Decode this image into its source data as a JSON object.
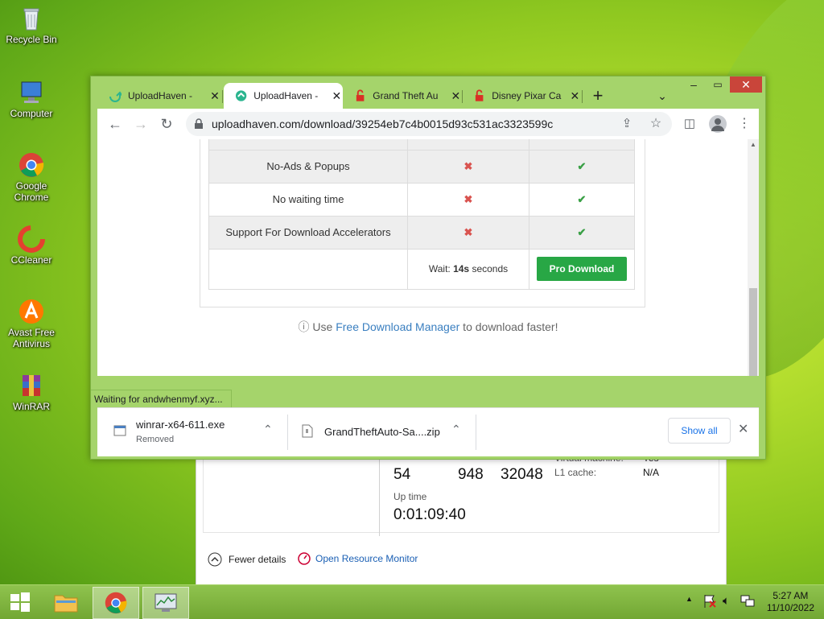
{
  "desktop": {
    "icons": [
      {
        "label": "Recycle Bin",
        "icon": "recycle-bin-icon"
      },
      {
        "label": "Computer",
        "icon": "computer-icon"
      },
      {
        "label": "Google Chrome",
        "icon": "chrome-icon"
      },
      {
        "label": "CCleaner",
        "icon": "ccleaner-icon"
      },
      {
        "label": "Avast Free Antivirus",
        "icon": "avast-icon"
      },
      {
        "label": "WinRAR",
        "icon": "winrar-icon"
      }
    ]
  },
  "browser": {
    "tabs": [
      {
        "title": "UploadHaven - ",
        "icon": "uploadhaven-icon",
        "active": false
      },
      {
        "title": "UploadHaven - ",
        "icon": "uploadhaven-icon",
        "active": true
      },
      {
        "title": "Grand Theft Au",
        "icon": "lock-warning-icon",
        "active": false
      },
      {
        "title": "Disney Pixar Ca",
        "icon": "lock-warning-icon",
        "active": false
      }
    ],
    "url": "uploadhaven.com/download/39254eb7c4b0015d93c531ac3323599c",
    "status_text": "Waiting for andwhenmyf.xyz...",
    "accent": "#a5d46b"
  },
  "page": {
    "features": [
      {
        "label": "No-Ads & Popups",
        "free": "✖",
        "pro": "✔"
      },
      {
        "label": "No waiting time",
        "free": "✖",
        "pro": "✔"
      },
      {
        "label": "Support For Download Accelerators",
        "free": "✖",
        "pro": "✔"
      }
    ],
    "wait_prefix": "Wait: ",
    "wait_value": "14s",
    "wait_suffix": " seconds",
    "pro_button": "Pro Download",
    "note_prefix": " Use ",
    "note_link": "Free Download Manager",
    "note_suffix": " to download faster!"
  },
  "downloads": {
    "items": [
      {
        "name": "winrar-x64-611.exe",
        "status": "Removed"
      },
      {
        "name": "GrandTheftAuto-Sa....zip",
        "status": ""
      }
    ],
    "show_all": "Show all"
  },
  "task_manager": {
    "numbers": [
      "54",
      "948",
      "32048"
    ],
    "side_labels": [
      "Virtual machine:",
      "L1 cache:"
    ],
    "side_values": [
      "Yes",
      "N/A"
    ],
    "uptime_label": "Up time",
    "uptime_value": "0:01:09:40",
    "fewer_details": "Fewer details",
    "open_resource_monitor": "Open Resource Monitor"
  },
  "taskbar": {
    "time": "5:27 AM",
    "date": "11/10/2022"
  }
}
